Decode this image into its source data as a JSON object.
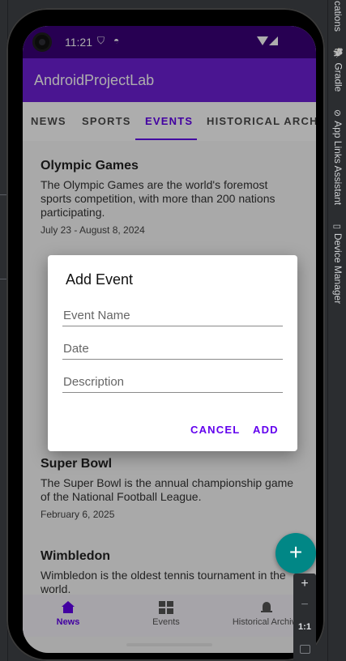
{
  "ide": {
    "right_tabs": [
      "cations",
      "Gradle",
      "App Links Assistant",
      "Device Manager"
    ]
  },
  "status_bar": {
    "time": "11:21"
  },
  "app": {
    "title": "AndroidProjectLab",
    "tabs": [
      "NEWS",
      "SPORTS",
      "EVENTS",
      "HISTORICAL ARCH"
    ],
    "active_tab": "EVENTS"
  },
  "cards": [
    {
      "title": "Olympic Games",
      "description": "The Olympic Games are the world's foremost sports competition, with more than 200 nations participating.",
      "date": "July 23 - August 8, 2024"
    },
    {
      "title": "Super Bowl",
      "description": "The Super Bowl is the annual championship game of the National Football League.",
      "date": "February 6, 2025"
    },
    {
      "title": "Wimbledon",
      "description": "Wimbledon is the oldest tennis tournament in the world."
    }
  ],
  "dialog": {
    "title": "Add Event",
    "fields": {
      "event_name": {
        "placeholder": "Event Name",
        "value": ""
      },
      "date": {
        "placeholder": "Date",
        "value": ""
      },
      "description": {
        "placeholder": "Description",
        "value": ""
      }
    },
    "cancel_label": "CANCEL",
    "add_label": "ADD"
  },
  "fab": {
    "label": "+"
  },
  "bottom_nav": [
    {
      "label": "News",
      "icon": "home-icon",
      "active": true
    },
    {
      "label": "Events",
      "icon": "dashboard-icon",
      "active": false
    },
    {
      "label": "Historical Archive",
      "icon": "bell-icon",
      "active": false
    }
  ],
  "zoom_controls": {
    "zoom_in": "+",
    "zoom_out": "−",
    "actual_size": "1:1"
  },
  "colors": {
    "status_bar": "#3a007a",
    "app_bar": "#6e1fd6",
    "accent": "#6200ee",
    "fab": "#018786"
  }
}
